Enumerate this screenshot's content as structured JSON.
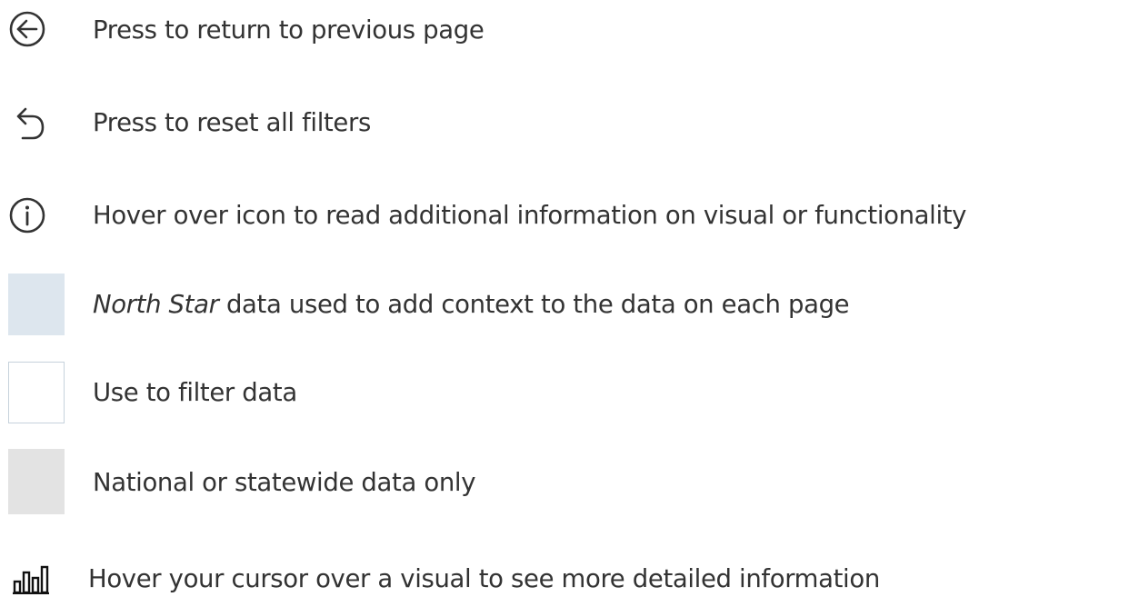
{
  "legend": {
    "items": [
      {
        "icon": "back-arrow-circle-icon",
        "label": "Press to return to previous page"
      },
      {
        "icon": "reset-undo-icon",
        "label": "Press to reset all filters"
      },
      {
        "icon": "info-circle-icon",
        "label": "Hover over icon to read additional information on visual or functionality"
      },
      {
        "icon": "swatch-light-blue",
        "label_italic": "North Star",
        "label": " data used to add context to the data on each page"
      },
      {
        "icon": "swatch-white-bordered",
        "label": "Use to filter data"
      },
      {
        "icon": "swatch-light-gray",
        "label": "National or statewide data only"
      },
      {
        "icon": "bar-chart-icon",
        "label": "Hover your cursor over a visual to see more detailed information"
      }
    ]
  },
  "colors": {
    "text": "#333333",
    "icon_stroke": "#333333",
    "north_star_swatch": "#dde6ee",
    "filter_swatch_border": "#c6d2dc",
    "national_swatch": "#e3e3e3"
  }
}
